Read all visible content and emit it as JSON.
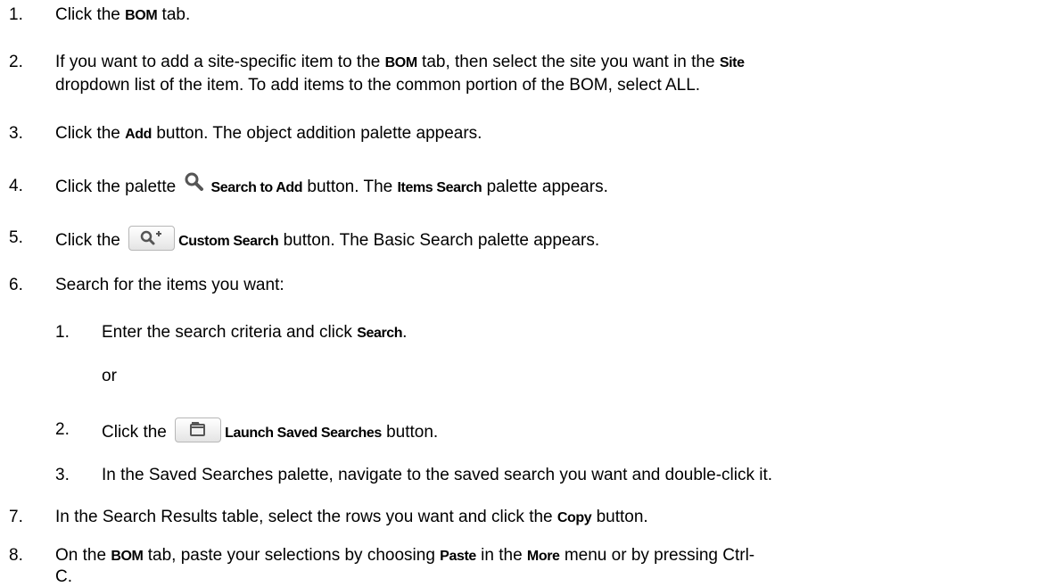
{
  "steps": [
    {
      "num": "1.",
      "parts": [
        "Click the ",
        "BOM",
        " tab."
      ]
    },
    {
      "num": "2.",
      "line1": [
        "If you want to add a site-specific item to the ",
        "BOM",
        " tab, then select the site you want in the ",
        "Site"
      ],
      "line2": [
        "dropdown list of the item. To add items to the common portion of the BOM, select ALL."
      ]
    },
    {
      "num": "3.",
      "parts": [
        "Click the ",
        "Add",
        " button. The object addition palette appears."
      ]
    },
    {
      "num": "4.",
      "parts": [
        "Click the palette ",
        "Search to Add",
        " button. The ",
        "Items Search",
        " palette appears."
      ],
      "icon": "search-icon"
    },
    {
      "num": "5.",
      "parts": [
        "Click the ",
        "Custom Search",
        " button. The Basic Search palette appears."
      ],
      "icon": "search-plus-icon"
    },
    {
      "num": "6.",
      "parts": [
        "Search for the items you want:"
      ]
    },
    {
      "num": "7.",
      "parts": [
        "In the Search Results table, select the rows you want and click the ",
        "Copy",
        " button."
      ]
    },
    {
      "num": "8.",
      "line1": [
        "On the ",
        "BOM",
        " tab, paste your selections by choosing ",
        "Paste",
        " in the ",
        "More",
        " menu or by pressing Ctrl-"
      ],
      "line2": [
        "C."
      ]
    }
  ],
  "substeps": [
    {
      "num": "1.",
      "parts": [
        "Enter the search criteria and click ",
        "Search",
        "."
      ]
    },
    {
      "or": "or"
    },
    {
      "num": "2.",
      "parts": [
        "Click the ",
        "Launch Saved Searches",
        " button."
      ],
      "icon": "folder-icon"
    },
    {
      "num": "3.",
      "parts": [
        "In the Saved Searches palette, navigate to the saved search you want and double-click it."
      ]
    }
  ]
}
